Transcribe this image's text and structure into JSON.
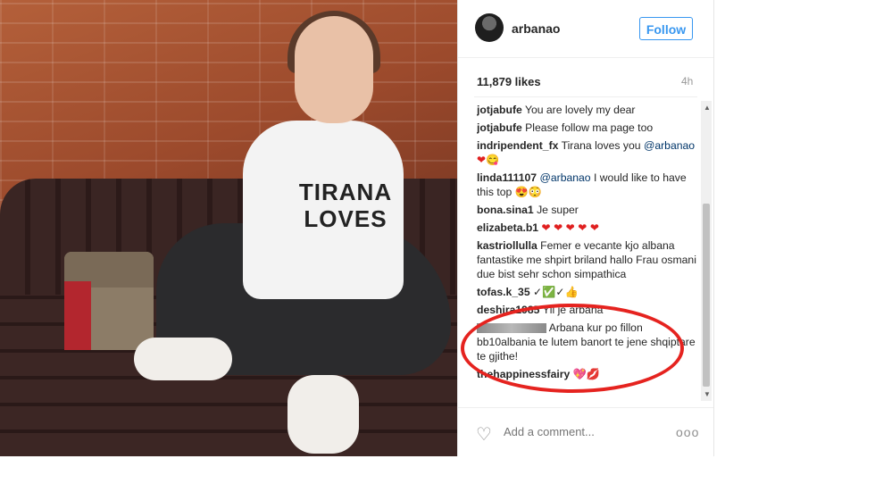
{
  "post": {
    "username": "arbanao",
    "follow_label": "Follow",
    "likes": "11,879 likes",
    "time_ago": "4h",
    "photo_shirt_text": [
      "TIRANA",
      "LOVES"
    ]
  },
  "comments": [
    {
      "user": "jotjabufe",
      "text": "You are lovely my dear"
    },
    {
      "user": "jotjabufe",
      "text": "Please follow ma page too"
    },
    {
      "user": "indripendent_fx",
      "text": "Tirana loves you",
      "mention": "@arbanao",
      "emoji": "❤😋"
    },
    {
      "user": "linda111107",
      "mention": "@arbanao",
      "text": "I would like to have this top",
      "emoji": "😍😳"
    },
    {
      "user": "bona.sina1",
      "text": "Je super"
    },
    {
      "user": "elizabeta.b1",
      "emoji": "❤ ❤ ❤ ❤ ❤"
    },
    {
      "user": "kastriollulla",
      "text": "Femer e vecante kjo albana fantastike me shpirt briland hallo Frau osmani due bist sehr schon simpathica"
    },
    {
      "user": "tofas.k_35",
      "emoji": "✓✅✓👍"
    },
    {
      "user": "deshira1985",
      "text": "Yll je arbana"
    },
    {
      "user": "",
      "text": "Arbana kur po fillon bb10albania te lutem banort te jene shqiptare te gjithe!"
    },
    {
      "user": "thehappinessfairy",
      "emoji": "💖💋"
    }
  ],
  "footer": {
    "add_comment_placeholder": "Add a comment...",
    "more": "ooo"
  },
  "colors": {
    "accent": "#3897f0",
    "annotation": "#e5231f",
    "heart": "#e02020"
  },
  "icons": [
    "heart-outline-icon",
    "more-options-icon",
    "scroll-up-icon",
    "scroll-down-icon"
  ]
}
